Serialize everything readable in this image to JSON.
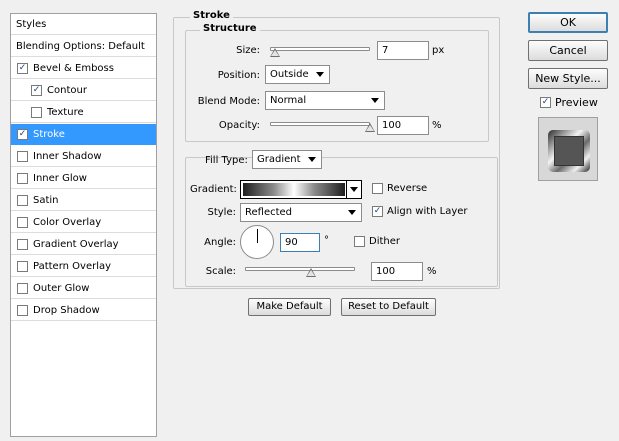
{
  "styles_panel": {
    "header": "Styles",
    "blending_options": "Blending Options: Default",
    "items": [
      {
        "label": "Bevel & Emboss",
        "checked": true
      },
      {
        "label": "Contour",
        "checked": true
      },
      {
        "label": "Texture",
        "checked": false
      },
      {
        "label": "Stroke",
        "checked": true
      },
      {
        "label": "Inner Shadow",
        "checked": false
      },
      {
        "label": "Inner Glow",
        "checked": false
      },
      {
        "label": "Satin",
        "checked": false
      },
      {
        "label": "Color Overlay",
        "checked": false
      },
      {
        "label": "Gradient Overlay",
        "checked": false
      },
      {
        "label": "Pattern Overlay",
        "checked": false
      },
      {
        "label": "Outer Glow",
        "checked": false
      },
      {
        "label": "Drop Shadow",
        "checked": false
      }
    ],
    "selected": "Stroke"
  },
  "stroke": {
    "title": "Stroke",
    "structure_title": "Structure",
    "size_label": "Size:",
    "size_value": "7",
    "size_unit": "px",
    "size_fraction": 0.05,
    "position_label": "Position:",
    "position_value": "Outside",
    "blend_mode_label": "Blend Mode:",
    "blend_mode_value": "Normal",
    "opacity_label": "Opacity:",
    "opacity_value": "100",
    "opacity_unit": "%",
    "opacity_fraction": 1.0,
    "fill_type_label": "Fill Type:",
    "fill_type_value": "Gradient",
    "gradient_label": "Gradient:",
    "reverse_label": "Reverse",
    "reverse_checked": false,
    "style_label": "Style:",
    "style_value": "Reflected",
    "align_label": "Align with Layer",
    "align_checked": true,
    "angle_label": "Angle:",
    "angle_value": "90",
    "angle_unit": "°",
    "dither_label": "Dither",
    "dither_checked": false,
    "scale_label": "Scale:",
    "scale_value": "100",
    "scale_unit": "%",
    "scale_fraction": 0.6,
    "make_default": "Make Default",
    "reset_default": "Reset to Default"
  },
  "actions": {
    "ok": "OK",
    "cancel": "Cancel",
    "new_style": "New Style...",
    "preview_label": "Preview",
    "preview_checked": true
  }
}
